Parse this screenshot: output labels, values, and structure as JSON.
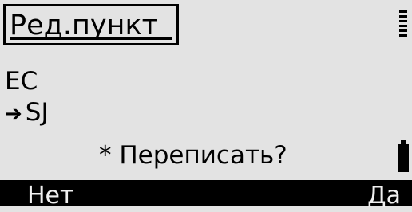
{
  "header": {
    "title": "Ред.пункт"
  },
  "content": {
    "line1": "EC",
    "line2_arrow": "➔",
    "line2": "SJ"
  },
  "prompt": {
    "text": "* Переписать?"
  },
  "softkeys": {
    "left": "Нет",
    "right": "Да"
  },
  "icons": {
    "signal": "signal-strength-icon",
    "battery": "battery-icon"
  }
}
